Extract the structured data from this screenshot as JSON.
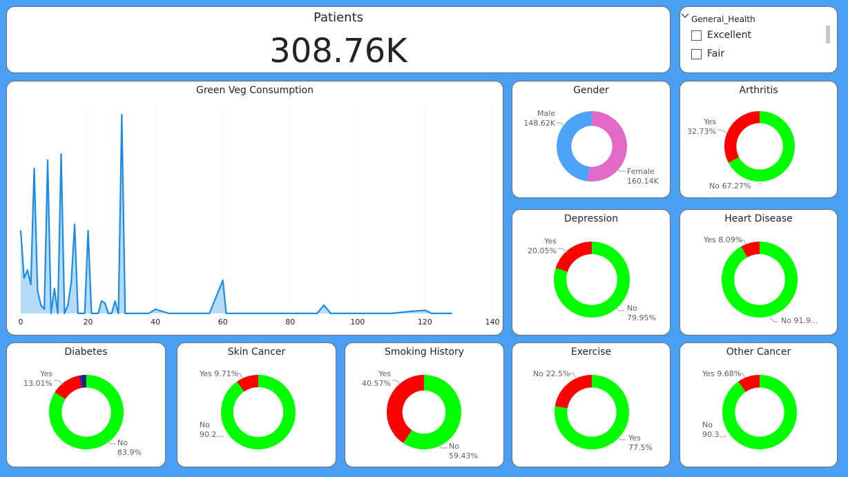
{
  "kpi": {
    "value": "308.76K",
    "label": "Patients"
  },
  "slicer": {
    "title": "General_Health",
    "options": [
      "Excellent",
      "Fair"
    ]
  },
  "colors": {
    "background": "#4a9ff2",
    "yes": "#ff0000",
    "no": "#00ff00",
    "male": "#4ca3f7",
    "female": "#e369c6",
    "line": "#1a8be6"
  },
  "line_chart": {
    "title": "Green Veg Consumption",
    "chart_data": {
      "type": "area",
      "title": "Green Veg Consumption",
      "xlim": [
        0,
        140
      ],
      "x_ticks": [
        "0",
        "20",
        "40",
        "60",
        "80",
        "100",
        "120",
        "140"
      ],
      "points": [
        [
          0,
          40
        ],
        [
          1,
          17
        ],
        [
          2,
          21
        ],
        [
          3,
          14
        ],
        [
          4,
          70
        ],
        [
          5,
          11
        ],
        [
          6,
          4
        ],
        [
          7,
          2
        ],
        [
          8,
          74
        ],
        [
          9,
          0
        ],
        [
          10,
          12
        ],
        [
          11,
          0
        ],
        [
          12,
          77
        ],
        [
          13,
          0
        ],
        [
          14,
          4
        ],
        [
          15,
          15
        ],
        [
          16,
          43
        ],
        [
          17,
          0
        ],
        [
          18,
          0
        ],
        [
          19,
          0
        ],
        [
          20,
          40
        ],
        [
          21,
          0
        ],
        [
          22,
          0
        ],
        [
          23,
          0
        ],
        [
          24,
          6
        ],
        [
          25,
          5
        ],
        [
          26,
          0
        ],
        [
          27,
          0
        ],
        [
          28,
          6
        ],
        [
          29,
          0
        ],
        [
          30,
          96
        ],
        [
          31,
          0
        ],
        [
          38,
          0
        ],
        [
          40,
          2
        ],
        [
          42,
          1
        ],
        [
          44,
          0
        ],
        [
          56,
          0
        ],
        [
          60,
          16
        ],
        [
          61,
          0
        ],
        [
          88,
          0
        ],
        [
          90,
          4
        ],
        [
          92,
          0
        ],
        [
          100,
          0
        ],
        [
          110,
          0
        ],
        [
          116,
          1
        ],
        [
          120,
          1.5
        ],
        [
          122,
          0
        ],
        [
          128,
          0
        ]
      ]
    }
  },
  "donuts": [
    {
      "id": "gender",
      "title": "Gender",
      "chart_data": {
        "type": "pie",
        "slices": [
          {
            "label": "Female",
            "value": 160.14,
            "color": "#e369c6"
          },
          {
            "label": "Male",
            "value": 148.62,
            "color": "#4ca3f7"
          }
        ]
      },
      "labels": [
        {
          "lines": [
            "Male",
            "148.62K"
          ]
        },
        {
          "lines": [
            "Female",
            "160.14K"
          ]
        }
      ]
    },
    {
      "id": "arthritis",
      "title": "Arthritis",
      "chart_data": {
        "type": "pie",
        "slices": [
          {
            "label": "No",
            "value": 67.27,
            "color": "#00ff00"
          },
          {
            "label": "Yes",
            "value": 32.73,
            "color": "#ff0000"
          }
        ]
      },
      "labels": [
        {
          "lines": [
            "Yes",
            "32.73%"
          ]
        },
        {
          "lines": [
            "No 67.27%"
          ]
        }
      ]
    },
    {
      "id": "depression",
      "title": "Depression",
      "chart_data": {
        "type": "pie",
        "slices": [
          {
            "label": "No",
            "value": 79.95,
            "color": "#00ff00"
          },
          {
            "label": "Yes",
            "value": 20.05,
            "color": "#ff0000"
          }
        ]
      },
      "labels": [
        {
          "lines": [
            "Yes",
            "20.05%"
          ]
        },
        {
          "lines": [
            "No",
            "79.95%"
          ]
        }
      ]
    },
    {
      "id": "heart",
      "title": "Heart Disease",
      "chart_data": {
        "type": "pie",
        "slices": [
          {
            "label": "No",
            "value": 91.91,
            "color": "#00ff00"
          },
          {
            "label": "Yes",
            "value": 8.09,
            "color": "#ff0000"
          }
        ]
      },
      "labels": [
        {
          "lines": [
            "Yes 8.09%"
          ]
        },
        {
          "lines": [
            "No 91.9..."
          ]
        }
      ]
    },
    {
      "id": "diabetes",
      "title": "Diabetes",
      "chart_data": {
        "type": "pie",
        "slices": [
          {
            "label": "No",
            "value": 83.9,
            "color": "#00ff00"
          },
          {
            "label": "Yes",
            "value": 13.01,
            "color": "#ff0000"
          },
          {
            "label": "",
            "value": 0.9,
            "color": "#4a148c"
          },
          {
            "label": "",
            "value": 2.19,
            "color": "#0d2a7a"
          }
        ]
      },
      "labels": [
        {
          "lines": [
            "Yes",
            "13.01%"
          ]
        },
        {
          "lines": [
            "No",
            "83.9%"
          ]
        }
      ]
    },
    {
      "id": "skin",
      "title": "Skin Cancer",
      "chart_data": {
        "type": "pie",
        "slices": [
          {
            "label": "No",
            "value": 90.29,
            "color": "#00ff00"
          },
          {
            "label": "Yes",
            "value": 9.71,
            "color": "#ff0000"
          }
        ]
      },
      "labels": [
        {
          "lines": [
            "Yes 9.71%"
          ]
        },
        {
          "lines": [
            "No",
            "90.2..."
          ]
        }
      ]
    },
    {
      "id": "smoking",
      "title": "Smoking History",
      "chart_data": {
        "type": "pie",
        "slices": [
          {
            "label": "No",
            "value": 59.43,
            "color": "#00ff00"
          },
          {
            "label": "Yes",
            "value": 40.57,
            "color": "#ff0000"
          }
        ]
      },
      "labels": [
        {
          "lines": [
            "Yes",
            "40.57%"
          ]
        },
        {
          "lines": [
            "No",
            "59.43%"
          ]
        }
      ]
    },
    {
      "id": "exercise",
      "title": "Exercise",
      "chart_data": {
        "type": "pie",
        "slices": [
          {
            "label": "Yes",
            "value": 77.5,
            "color": "#00ff00"
          },
          {
            "label": "No",
            "value": 22.5,
            "color": "#ff0000"
          }
        ]
      },
      "labels": [
        {
          "lines": [
            "No 22.5%"
          ]
        },
        {
          "lines": [
            "Yes",
            "77.5%"
          ]
        }
      ]
    },
    {
      "id": "other",
      "title": "Other Cancer",
      "chart_data": {
        "type": "pie",
        "slices": [
          {
            "label": "No",
            "value": 90.32,
            "color": "#00ff00"
          },
          {
            "label": "Yes",
            "value": 9.68,
            "color": "#ff0000"
          }
        ]
      },
      "labels": [
        {
          "lines": [
            "Yes 9.68%"
          ]
        },
        {
          "lines": [
            "No",
            "90.3..."
          ]
        }
      ]
    }
  ]
}
